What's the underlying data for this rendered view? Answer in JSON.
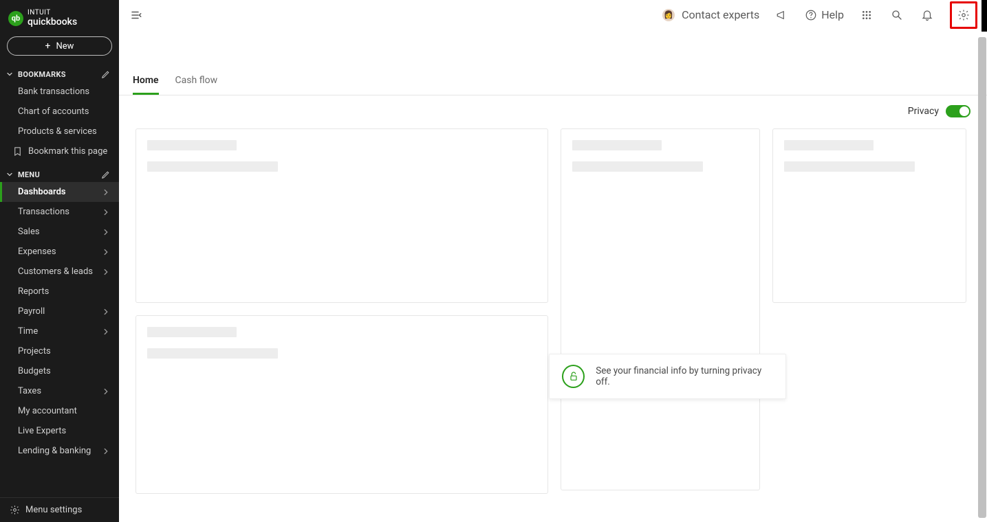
{
  "brand": {
    "intuit": "INTUIT",
    "product": "quickbooks",
    "qb_badge": "qb"
  },
  "sidebar": {
    "new_label": "New",
    "bookmarks_label": "BOOKMARKS",
    "menu_label": "MENU",
    "bookmarks": [
      {
        "label": "Bank transactions"
      },
      {
        "label": "Chart of accounts"
      },
      {
        "label": "Products & services"
      }
    ],
    "bookmark_this": "Bookmark this page",
    "menu": [
      {
        "label": "Dashboards",
        "has_children": true,
        "active": true
      },
      {
        "label": "Transactions",
        "has_children": true
      },
      {
        "label": "Sales",
        "has_children": true
      },
      {
        "label": "Expenses",
        "has_children": true
      },
      {
        "label": "Customers & leads",
        "has_children": true
      },
      {
        "label": "Reports",
        "has_children": false
      },
      {
        "label": "Payroll",
        "has_children": true
      },
      {
        "label": "Time",
        "has_children": true
      },
      {
        "label": "Projects",
        "has_children": false
      },
      {
        "label": "Budgets",
        "has_children": false
      },
      {
        "label": "Taxes",
        "has_children": true
      },
      {
        "label": "My accountant",
        "has_children": false
      },
      {
        "label": "Live Experts",
        "has_children": false
      },
      {
        "label": "Lending & banking",
        "has_children": true
      }
    ],
    "menu_settings": "Menu settings"
  },
  "topbar": {
    "contact_experts": "Contact experts",
    "help": "Help"
  },
  "tabs": [
    {
      "label": "Home",
      "active": true
    },
    {
      "label": "Cash flow",
      "active": false
    }
  ],
  "privacy": {
    "label": "Privacy",
    "on": true
  },
  "tip": {
    "text": "See your financial info by turning privacy off."
  }
}
